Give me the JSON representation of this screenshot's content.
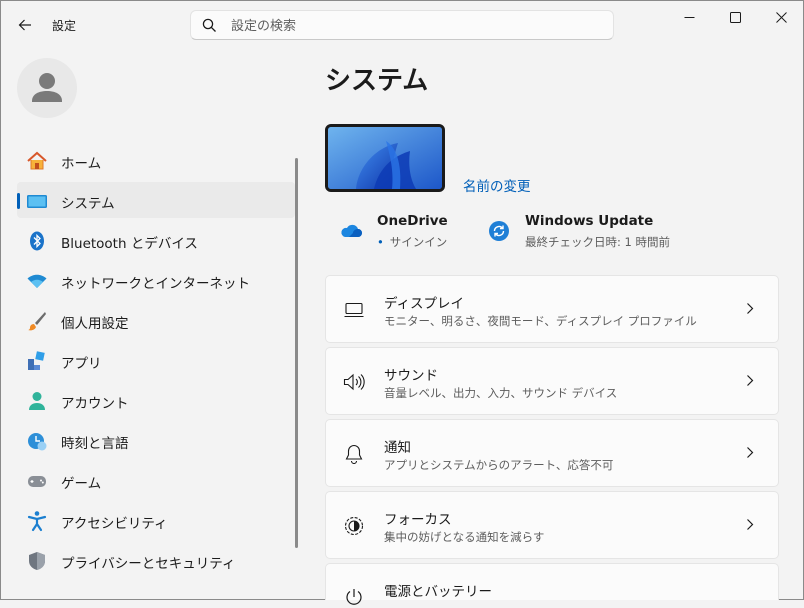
{
  "app": {
    "title": "設定"
  },
  "search": {
    "placeholder": "設定の検索",
    "value": ""
  },
  "sidebar": {
    "items": [
      {
        "label": "ホーム",
        "icon": "home-icon"
      },
      {
        "label": "システム",
        "icon": "system-icon",
        "active": true
      },
      {
        "label": "Bluetooth とデバイス",
        "icon": "bluetooth-icon"
      },
      {
        "label": "ネットワークとインターネット",
        "icon": "network-icon"
      },
      {
        "label": "個人用設定",
        "icon": "personalization-icon"
      },
      {
        "label": "アプリ",
        "icon": "apps-icon"
      },
      {
        "label": "アカウント",
        "icon": "accounts-icon"
      },
      {
        "label": "時刻と言語",
        "icon": "time-language-icon"
      },
      {
        "label": "ゲーム",
        "icon": "gaming-icon"
      },
      {
        "label": "アクセシビリティ",
        "icon": "accessibility-icon"
      },
      {
        "label": "プライバシーとセキュリティ",
        "icon": "privacy-security-icon"
      }
    ]
  },
  "main": {
    "title": "システム",
    "rename_link": "名前の変更",
    "status": {
      "onedrive": {
        "title": "OneDrive",
        "subtitle": "サインイン"
      },
      "windows_update": {
        "title": "Windows Update",
        "subtitle": "最終チェック日時: 1 時間前"
      }
    },
    "cards": [
      {
        "title": "ディスプレイ",
        "subtitle": "モニター、明るさ、夜間モード、ディスプレイ プロファイル",
        "icon": "display-icon"
      },
      {
        "title": "サウンド",
        "subtitle": "音量レベル、出力、入力、サウンド デバイス",
        "icon": "sound-icon"
      },
      {
        "title": "通知",
        "subtitle": "アプリとシステムからのアラート、応答不可",
        "icon": "notification-bell-icon"
      },
      {
        "title": "フォーカス",
        "subtitle": "集中の妨げとなる通知を減らす",
        "icon": "focus-icon"
      },
      {
        "title": "電源とバッテリー",
        "subtitle": "",
        "icon": "power-icon"
      }
    ]
  },
  "colors": {
    "accent": "#005fb8",
    "background": "#f3f3f3",
    "card": "#fbfbfb"
  }
}
